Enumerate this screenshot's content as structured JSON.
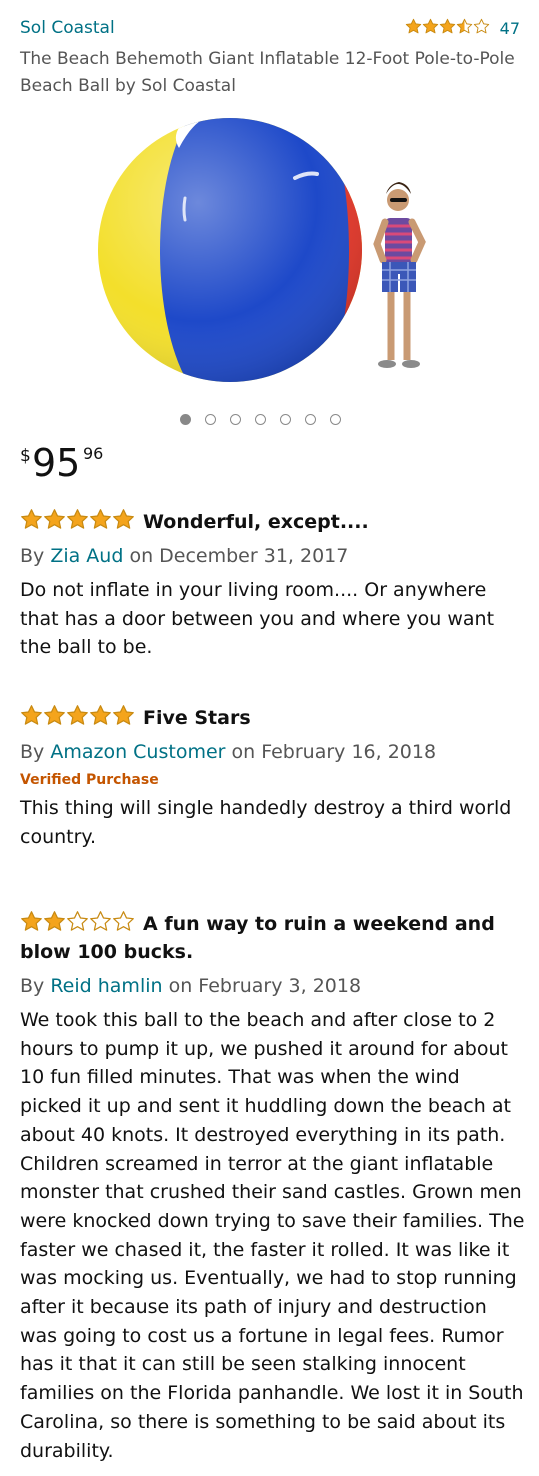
{
  "product": {
    "brand": "Sol Coastal",
    "rating": 3.5,
    "rating_count": "47",
    "title": "The Beach Behemoth Giant Inflatable 12-Foot Pole-to-Pole Beach Ball by Sol Coastal",
    "image_icon": "beach-ball-with-man",
    "carousel_total": 7,
    "carousel_active": 1,
    "price": {
      "currency": "$",
      "whole": "95",
      "fraction": "96"
    }
  },
  "reviews": [
    {
      "stars": 5,
      "title": "Wonderful, except....",
      "by_prefix": "By",
      "author": "Zia Aud",
      "date": "on December 31, 2017",
      "verified": "",
      "text": "Do not inflate in your living room.... Or anywhere that has a door between you and where you want the ball to be."
    },
    {
      "stars": 5,
      "title": "Five Stars",
      "by_prefix": "By",
      "author": "Amazon Customer",
      "date": "on February 16, 2018",
      "verified": "Verified Purchase",
      "text": "This thing will single handedly destroy a third world country."
    },
    {
      "stars": 2,
      "title": "A fun way to ruin a weekend and blow 100 bucks.",
      "by_prefix": "By",
      "author": "Reid hamlin",
      "date": "on February 3, 2018",
      "verified": "",
      "text": "We took this ball to the beach and after close to 2 hours to pump it up, we pushed it around for about 10 fun filled minutes. That was when the wind picked it up and sent it huddling down the beach at about 40 knots. It destroyed everything in its path. Children screamed in terror at the giant inflatable monster that crushed their sand castles. Grown men were knocked down trying to save their families. The faster we chased it, the faster it rolled. It was like it was mocking us. Eventually, we had to stop running after it because its path of injury and destruction was going to cost us a fortune in legal fees. Rumor has it that it can still be seen stalking innocent families on the Florida panhandle. We lost it in South Carolina, so there is something to be said about its durability."
    }
  ],
  "colors": {
    "link": "#007185",
    "star": "#f4a41c",
    "verified": "#c45500"
  }
}
